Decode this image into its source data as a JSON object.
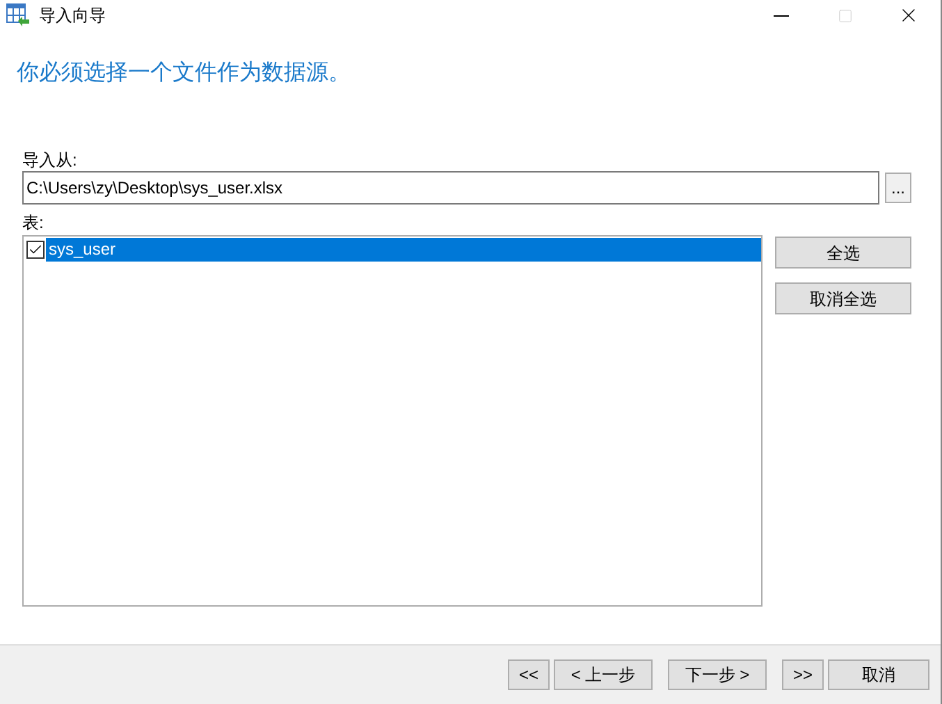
{
  "window": {
    "title": "导入向导",
    "maximize_disabled": true
  },
  "heading": "你必须选择一个文件作为数据源。",
  "import_from": {
    "label": "导入从:",
    "value": "C:\\Users\\zy\\Desktop\\sys_user.xlsx",
    "browse": "..."
  },
  "tables": {
    "label": "表:",
    "items": [
      {
        "name": "sys_user",
        "checked": true,
        "selected": true
      }
    ]
  },
  "side_buttons": [
    "全选",
    "取消全选"
  ],
  "footer_buttons": [
    {
      "label": "<<",
      "kind": "narrow"
    },
    {
      "label": "< 上一步",
      "kind": "wide"
    },
    {
      "label": "下一步 >",
      "kind": "wide"
    },
    {
      "label": ">>",
      "kind": "narrow"
    },
    {
      "label": "取消",
      "kind": "cancel"
    }
  ]
}
